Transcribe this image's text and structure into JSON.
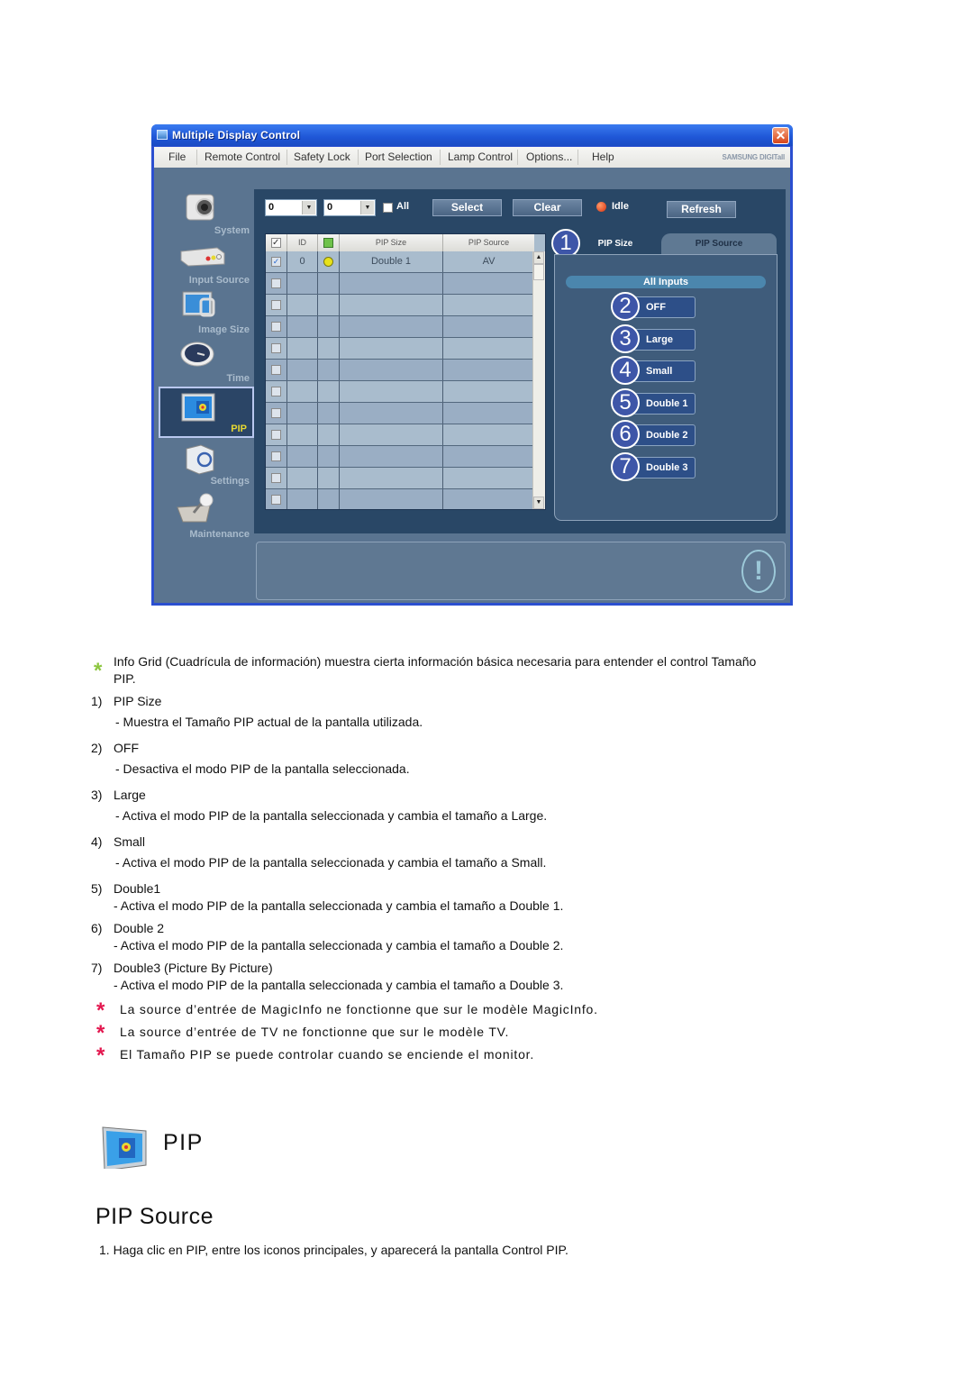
{
  "window": {
    "title": "Multiple Display Control",
    "close_glyph": "✕",
    "brand": "SAMSUNG DIGITall",
    "menu": [
      "File",
      "Remote Control",
      "Safety Lock",
      "Port Selection",
      "Lamp Control",
      "Options...",
      "Help"
    ]
  },
  "sidebar": {
    "items": [
      {
        "label": "System",
        "icon": "camera-icon",
        "active": false
      },
      {
        "label": "Input Source",
        "icon": "av-box-icon",
        "active": false
      },
      {
        "label": "Image Size",
        "icon": "monitor-resize-icon",
        "active": false
      },
      {
        "label": "Time",
        "icon": "clock-icon",
        "active": false
      },
      {
        "label": "PIP",
        "icon": "pip-monitor-icon",
        "active": true
      },
      {
        "label": "Settings",
        "icon": "settings-cube-icon",
        "active": false
      },
      {
        "label": "Maintenance",
        "icon": "maintenance-icon",
        "active": false
      }
    ]
  },
  "toolbar": {
    "combo1_value": "0",
    "combo2_value": "0",
    "all_label": "All",
    "all_checked": false,
    "select_label": "Select",
    "clear_label": "Clear",
    "status_label": "Idle",
    "status_color": "#d8300c",
    "refresh_label": "Refresh"
  },
  "grid": {
    "columns": [
      "",
      "ID",
      "",
      "PIP Size",
      "PIP Source"
    ],
    "rows": [
      {
        "checked": true,
        "id": "0",
        "power": "on",
        "pip_size": "Double 1",
        "pip_source": "AV"
      },
      {
        "checked": false,
        "id": "",
        "power": "",
        "pip_size": "",
        "pip_source": ""
      },
      {
        "checked": false,
        "id": "",
        "power": "",
        "pip_size": "",
        "pip_source": ""
      },
      {
        "checked": false,
        "id": "",
        "power": "",
        "pip_size": "",
        "pip_source": ""
      },
      {
        "checked": false,
        "id": "",
        "power": "",
        "pip_size": "",
        "pip_source": ""
      },
      {
        "checked": false,
        "id": "",
        "power": "",
        "pip_size": "",
        "pip_source": ""
      },
      {
        "checked": false,
        "id": "",
        "power": "",
        "pip_size": "",
        "pip_source": ""
      },
      {
        "checked": false,
        "id": "",
        "power": "",
        "pip_size": "",
        "pip_source": ""
      },
      {
        "checked": false,
        "id": "",
        "power": "",
        "pip_size": "",
        "pip_source": ""
      },
      {
        "checked": false,
        "id": "",
        "power": "",
        "pip_size": "",
        "pip_source": ""
      },
      {
        "checked": false,
        "id": "",
        "power": "",
        "pip_size": "",
        "pip_source": ""
      },
      {
        "checked": false,
        "id": "",
        "power": "",
        "pip_size": "",
        "pip_source": ""
      }
    ]
  },
  "tabs": {
    "active": "PIP Size",
    "items": [
      "PIP Size",
      "PIP Source"
    ],
    "callout": "1",
    "section_label": "All Inputs",
    "buttons": [
      {
        "callout": "2",
        "label": "OFF"
      },
      {
        "callout": "3",
        "label": "Large"
      },
      {
        "callout": "4",
        "label": "Small"
      },
      {
        "callout": "5",
        "label": "Double 1"
      },
      {
        "callout": "6",
        "label": "Double 2"
      },
      {
        "callout": "7",
        "label": "Double 3"
      }
    ]
  },
  "status_panel": {
    "icon": "warning-icon",
    "glyph": "!"
  },
  "doc": {
    "star_glyph": "*",
    "intro": "Info Grid (Cuadrícula de información) muestra cierta información básica necesaria para entender el control Tamaño",
    "intro_cont": "PIP.",
    "items": [
      {
        "num": "1)",
        "title": "PIP Size",
        "desc": "- Muestra el Tamaño PIP actual de la pantalla utilizada."
      },
      {
        "num": "2)",
        "title": "OFF",
        "desc": "- Desactiva el modo PIP de la pantalla seleccionada."
      },
      {
        "num": "3)",
        "title": "Large",
        "desc": "- Activa el modo PIP de la pantalla seleccionada y cambia el tamaño a Large."
      },
      {
        "num": "4)",
        "title": "Small",
        "desc": "- Activa el modo PIP de la pantalla seleccionada y cambia el tamaño a Small."
      },
      {
        "num": "5)",
        "title": "Double1",
        "desc": "- Activa el modo PIP de la pantalla seleccionada y cambia el tamaño a Double 1."
      },
      {
        "num": "6)",
        "title": "Double 2",
        "desc": "- Activa el modo PIP de la pantalla seleccionada y cambia el tamaño a Double 2."
      },
      {
        "num": "7)",
        "title": "Double3 (Picture By Picture)",
        "desc": "- Activa el modo PIP de la pantalla seleccionada y cambia el tamaño a Double 3."
      }
    ],
    "notes": [
      "La source d’entrée de MagicInfo ne fonctionne que sur le modèle MagicInfo.",
      "La source d’entrée de TV ne fonctionne que sur le modèle TV.",
      "El Tamaño PIP se puede controlar cuando se enciende el monitor."
    ],
    "heading_pip": "PIP",
    "heading_source": "PIP Source",
    "step1": "1.  Haga clic en PIP, entre los iconos principales, y aparecerá la pantalla Control PIP."
  },
  "colors": {
    "titlebar": "#1f56d6",
    "panel": "#294766",
    "client": "#5a7490",
    "star_green": "#8cc63f",
    "star_red": "#e3174f",
    "pip_label": "#e6d832"
  }
}
